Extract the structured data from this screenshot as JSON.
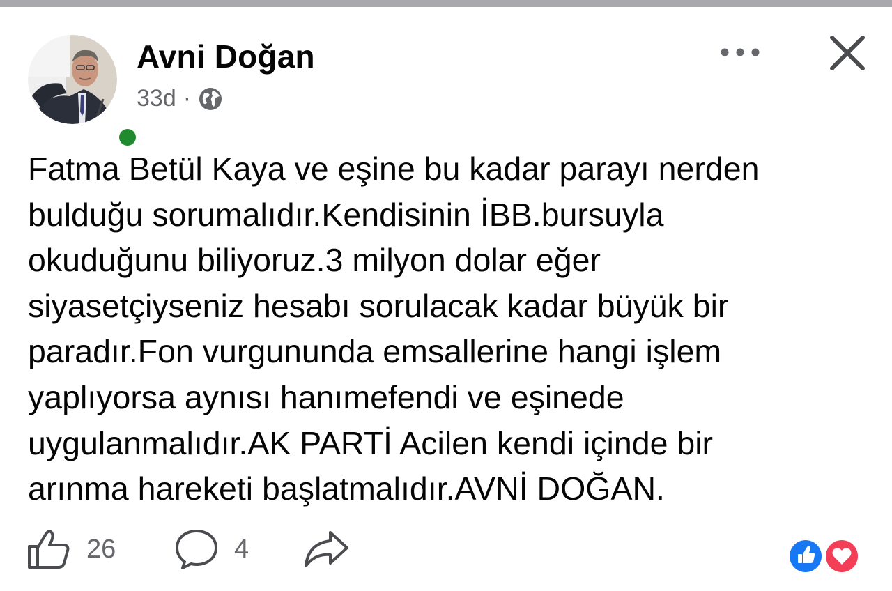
{
  "post": {
    "author_name": "Avni Doğan",
    "timestamp": "33d",
    "separator": "·",
    "privacy_icon": "globe-icon",
    "online_status": "online",
    "body_lines": [
      "Fatma Betül Kaya ve eşine bu kadar parayı nerden",
      "bulduğu sorumalıdır.Kendisinin İBB.bursuyla",
      "okuduğunu biliyoruz.3 milyon dolar eğer",
      "siyasetçiyseniz hesabı sorulacak kadar büyük bir",
      "paradır.Fon vurgununda emsallerine hangi işlem",
      "yaplıyorsa aynısı hanımefendi ve eşinede",
      "uygulanmalıdır.AK PARTİ Acilen kendi içinde bir",
      "arınma hareketi başlatmalıdır.AVNİ DOĞAN."
    ]
  },
  "actions": {
    "like_count": "26",
    "comment_count": "4",
    "like_icon": "thumbs-up-icon",
    "comment_icon": "comment-bubble-icon",
    "share_icon": "share-arrow-icon"
  },
  "reactions": [
    "like-reaction-icon",
    "love-reaction-icon"
  ],
  "colors": {
    "like_blue": "#1877f2",
    "love_red": "#f33e58",
    "online_green": "#1f8b2e",
    "secondary_text": "#65676b"
  }
}
